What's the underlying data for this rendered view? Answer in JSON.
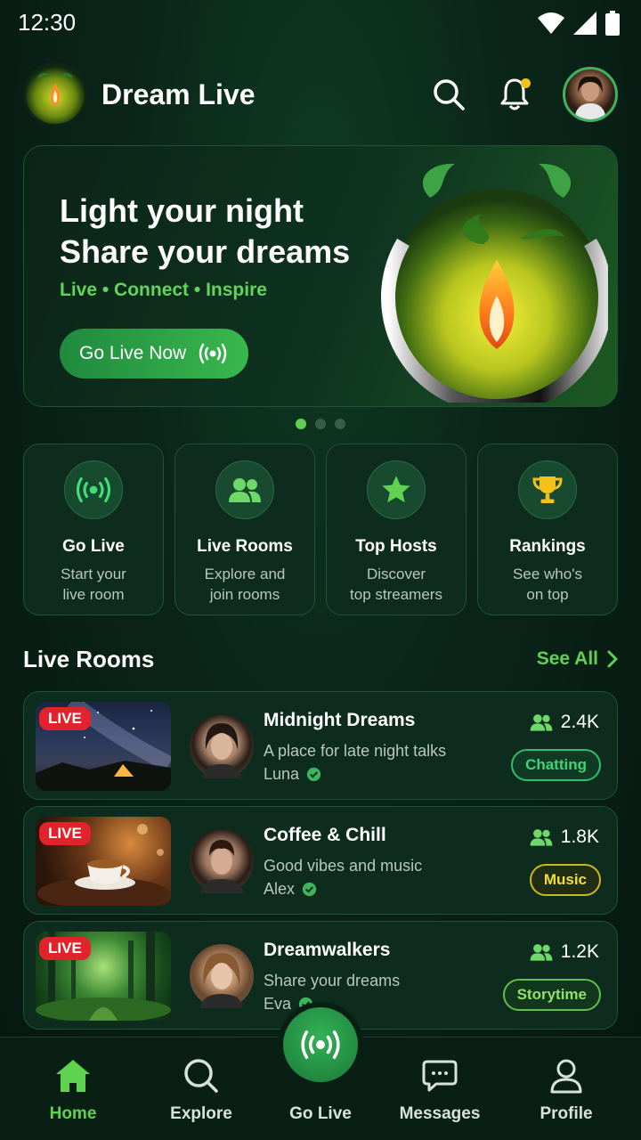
{
  "status_bar": {
    "time": "12:30"
  },
  "header": {
    "title": "Dream Live"
  },
  "hero": {
    "title_line1": "Light your night",
    "title_line2": "Share your dreams",
    "subtitle": "Live • Connect • Inspire",
    "button_label": "Go Live Now",
    "carousel_pages": 3,
    "carousel_active": 1
  },
  "quick_actions": [
    {
      "title": "Go Live",
      "desc_line1": "Start your",
      "desc_line2": "live room",
      "icon": "broadcast-icon"
    },
    {
      "title": "Live Rooms",
      "desc_line1": "Explore and",
      "desc_line2": "join rooms",
      "icon": "users-icon"
    },
    {
      "title": "Top Hosts",
      "desc_line1": "Discover",
      "desc_line2": "top streamers",
      "icon": "star-icon"
    },
    {
      "title": "Rankings",
      "desc_line1": "See who's",
      "desc_line2": "on top",
      "icon": "trophy-icon"
    }
  ],
  "live_rooms": {
    "title": "Live Rooms",
    "see_all": "See All",
    "items": [
      {
        "badge": "LIVE",
        "title": "Midnight Dreams",
        "desc": "A place for late night talks",
        "host": "Luna",
        "viewers": "2.4K",
        "tag": "Chatting",
        "tag_color": "#2fbf6a"
      },
      {
        "badge": "LIVE",
        "title": "Coffee & Chill",
        "desc": "Good vibes and music",
        "host": "Alex",
        "viewers": "1.8K",
        "tag": "Music",
        "tag_color": "#e6d21f"
      },
      {
        "badge": "LIVE",
        "title": "Dreamwalkers",
        "desc": "Share your dreams",
        "host": "Eva",
        "viewers": "1.2K",
        "tag": "Storytime",
        "tag_color": "#8fe36b"
      }
    ]
  },
  "nav": {
    "home": "Home",
    "explore": "Explore",
    "go_live": "Go Live",
    "messages": "Messages",
    "profile": "Profile",
    "active": "home"
  },
  "colors": {
    "accent": "#5fd24f",
    "live_red": "#e3232c",
    "card_bg": "#0e2c1d"
  }
}
